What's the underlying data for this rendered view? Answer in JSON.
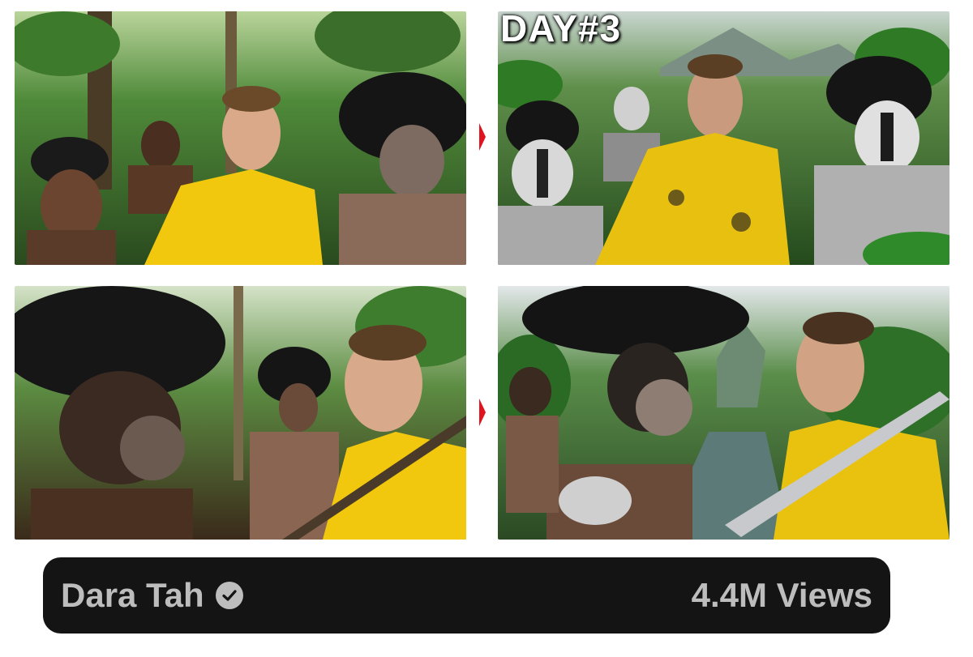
{
  "thumbnails": {
    "overlay_label": "DAY#3"
  },
  "info_bar": {
    "channel_name": "Dara Tah",
    "verified_icon": "check-circle-icon",
    "views": "4.4M Views"
  },
  "colors": {
    "jacket_yellow": "#f2c80f",
    "arrow_red": "#e0141e",
    "bar_bg": "#141414",
    "bar_text": "#bdbdbd",
    "jungle_green": "#2f6b2a"
  }
}
